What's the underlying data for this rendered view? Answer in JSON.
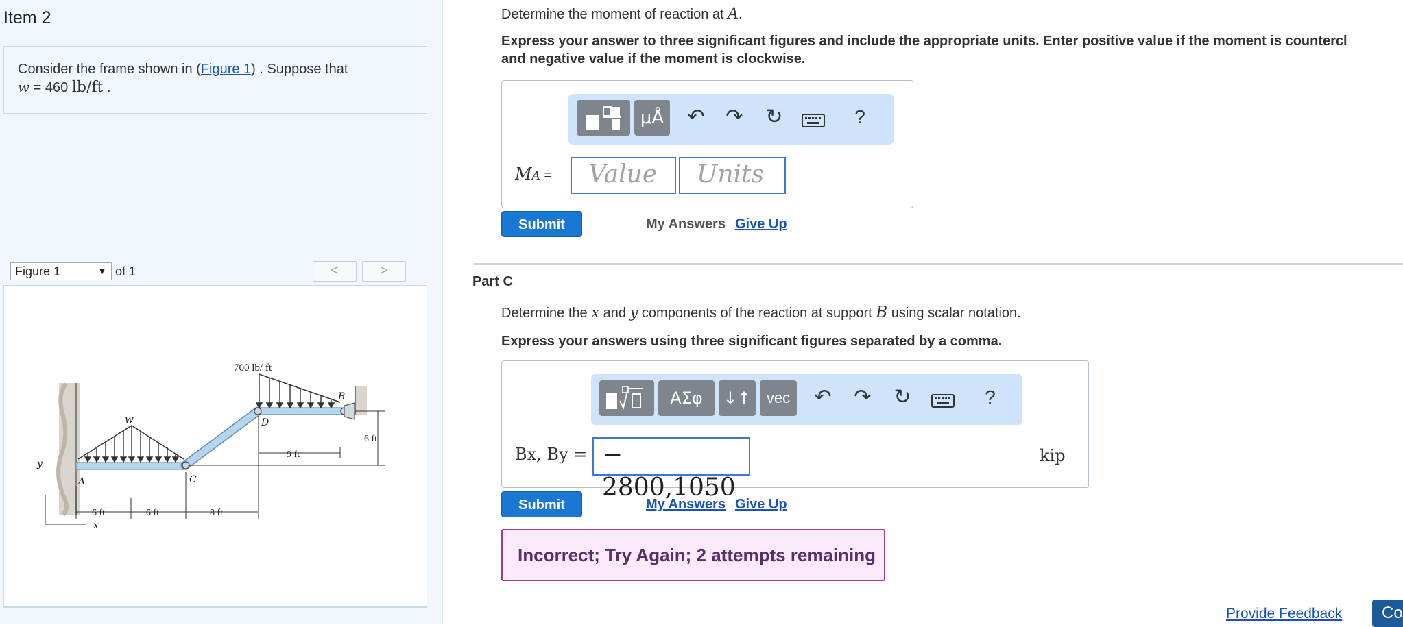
{
  "item": {
    "title": "Item 2"
  },
  "problem": {
    "prefix": "Consider the frame shown in (",
    "figure_link": "Figure 1",
    "suffix": ") . Suppose that",
    "var": "w",
    "eq": " = 460",
    "unit": "lb/ft",
    "end": "."
  },
  "figure_nav": {
    "selected": "Figure 1",
    "of_text": "of 1",
    "prev": "<",
    "next": ">"
  },
  "figure": {
    "load_top": "700 lb/ ft",
    "label_w": "w",
    "label_A": "A",
    "label_B": "B",
    "label_C": "C",
    "label_D": "D",
    "label_x": "x",
    "label_y": "y",
    "dim_9ft": "9 ft",
    "dim_6ft_right": "6 ft",
    "dim_6ft_a": "6 ft",
    "dim_6ft_b": "6 ft",
    "dim_8ft": "8 ft"
  },
  "partB": {
    "question_prefix": "Determine the moment of reaction at ",
    "question_var": "A",
    "question_end": ".",
    "instruction_line1": "Express your answer to three significant figures and include the appropriate units. Enter positive value if the moment is countercl",
    "instruction_line2": "and negative value if the moment is clockwise.",
    "toolbar": {
      "templates_icon": "templates-icon",
      "units_label": "μÅ",
      "help": "?"
    },
    "label_var": "M",
    "label_sub": "A",
    "label_eq": " =",
    "value_placeholder": "Value",
    "units_placeholder": "Units",
    "submit": "Submit",
    "my_answers": "My Answers",
    "give_up": "Give Up"
  },
  "partC": {
    "title": "Part C",
    "question_prefix": "Determine the ",
    "x_var": "x",
    "and_text": " and ",
    "y_var": "y",
    "question_mid": " components of the reaction at support ",
    "b_var": "B",
    "question_end": " using scalar notation.",
    "instruction": "Express your answers using three significant figures separated by a comma.",
    "toolbar": {
      "sym_label": "ΑΣφ",
      "arrows_label": "↓↑",
      "vec_label": "vec",
      "help": "?"
    },
    "label_text": "Bx, By =",
    "answer_value": "− 2800,1050",
    "unit": "kip",
    "submit": "Submit",
    "my_answers": "My Answers",
    "give_up": "Give Up",
    "feedback": "Incorrect; Try Again; 2 attempts remaining"
  },
  "footer": {
    "provide_feedback": "Provide Feedback",
    "continue": "Co"
  }
}
